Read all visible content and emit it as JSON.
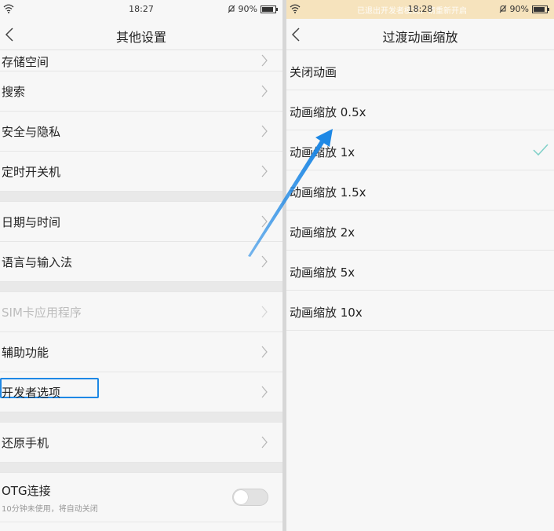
{
  "left": {
    "status": {
      "time": "18:27",
      "battery": "90%",
      "battery_level": 0.9
    },
    "title": "其他设置",
    "rows": [
      {
        "label": "存储空间"
      },
      {
        "label": "搜索"
      },
      {
        "label": "安全与隐私"
      },
      {
        "label": "定时开关机"
      },
      {
        "label": "日期与时间"
      },
      {
        "label": "语言与输入法"
      },
      {
        "label": "SIM卡应用程序",
        "disabled": true
      },
      {
        "label": "辅助功能"
      },
      {
        "label": "开发者选项",
        "highlighted": true
      },
      {
        "label": "还原手机"
      }
    ],
    "otg": {
      "label": "OTG连接",
      "sub": "10分钟未使用，将自动关闭",
      "enabled": false
    }
  },
  "right": {
    "status": {
      "time": "18:28",
      "battery": "90%",
      "battery_level": 0.9,
      "banner": "已退出开发者模式，请重新开启"
    },
    "title": "过渡动画缩放",
    "options": [
      {
        "label": "关闭动画",
        "selected": false
      },
      {
        "label": "动画缩放 0.5x",
        "selected": false
      },
      {
        "label": "动画缩放 1x",
        "selected": true
      },
      {
        "label": "动画缩放 1.5x",
        "selected": false
      },
      {
        "label": "动画缩放 2x",
        "selected": false
      },
      {
        "label": "动画缩放 5x",
        "selected": false
      },
      {
        "label": "动画缩放 10x",
        "selected": false
      }
    ]
  },
  "colors": {
    "accent": "#1e88e5",
    "check": "#7fd0c8",
    "banner_bg": "#f6e3bd"
  },
  "icons": {
    "back": "chevron-left-icon",
    "row": "chevron-right-icon",
    "selected": "checkmark-icon",
    "wifi": "wifi-icon",
    "alarm": "bell-off-icon",
    "battery": "battery-icon"
  }
}
